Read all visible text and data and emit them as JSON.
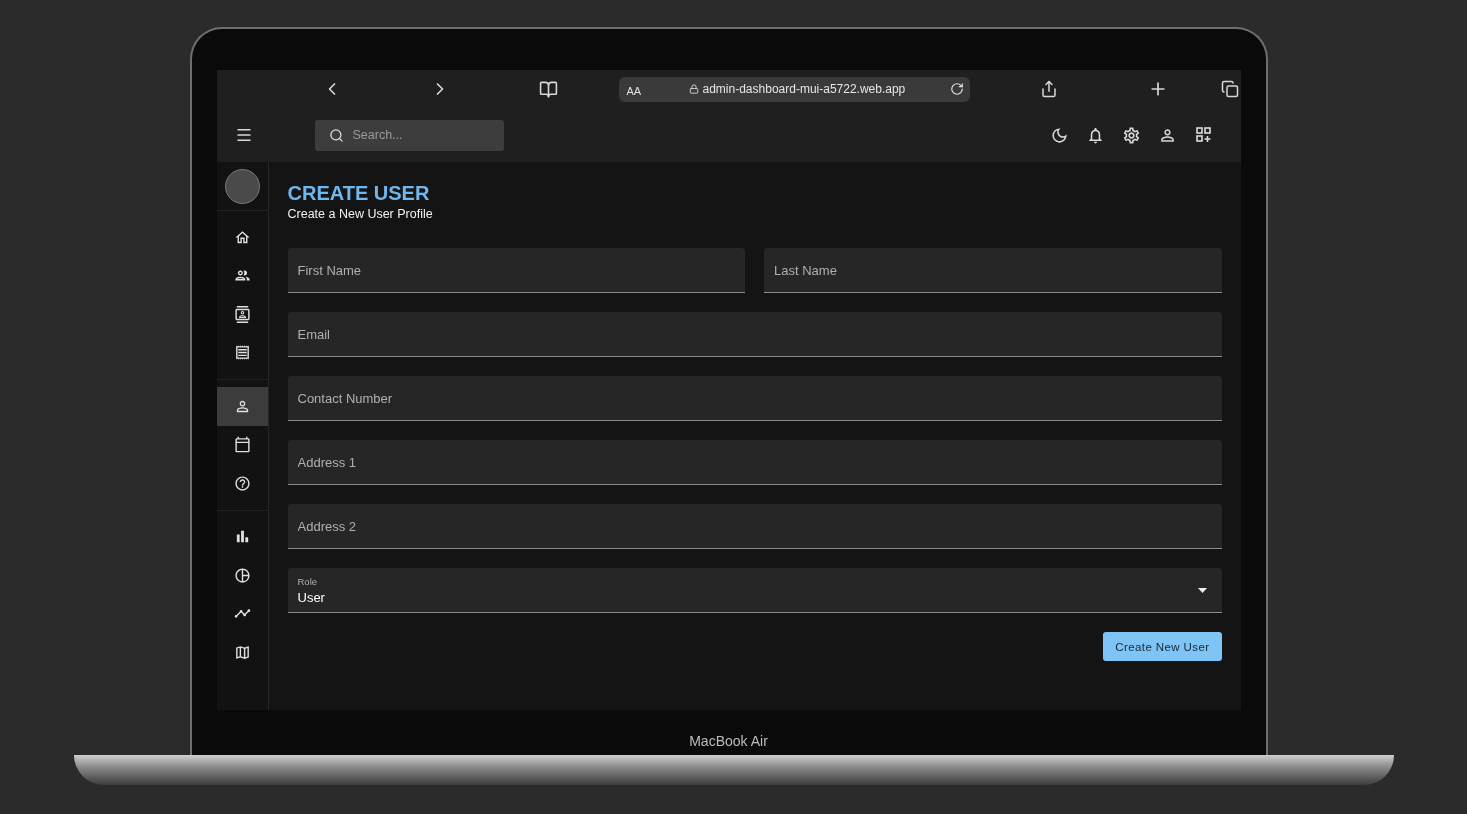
{
  "browser": {
    "text_size_label": "AA",
    "url": "admin-dashboard-mui-a5722.web.app"
  },
  "topbar": {
    "search": {
      "placeholder": "Search..."
    }
  },
  "sidebar": {
    "groups": [
      {
        "items": [
          {
            "selected": false
          },
          {
            "selected": false
          },
          {
            "selected": false
          },
          {
            "selected": false
          }
        ]
      },
      {
        "items": [
          {
            "selected": true
          },
          {
            "selected": false
          },
          {
            "selected": false
          }
        ]
      },
      {
        "items": [
          {
            "selected": false
          },
          {
            "selected": false
          },
          {
            "selected": false
          },
          {
            "selected": false
          }
        ]
      }
    ]
  },
  "page": {
    "title": "CREATE USER",
    "subtitle": "Create a New User Profile"
  },
  "form": {
    "rows": [
      [
        {
          "kind": "text",
          "placeholder": "First Name"
        },
        {
          "kind": "text",
          "placeholder": "Last Name"
        }
      ],
      [
        {
          "kind": "text",
          "placeholder": "Email"
        }
      ],
      [
        {
          "kind": "text",
          "placeholder": "Contact Number"
        }
      ],
      [
        {
          "kind": "text",
          "placeholder": "Address 1"
        }
      ],
      [
        {
          "kind": "text",
          "placeholder": "Address 2"
        }
      ],
      [
        {
          "kind": "select",
          "label": "Role",
          "value": "User"
        }
      ]
    ],
    "submit_button": "Create New User"
  },
  "device": {
    "label": "MacBook Air"
  }
}
